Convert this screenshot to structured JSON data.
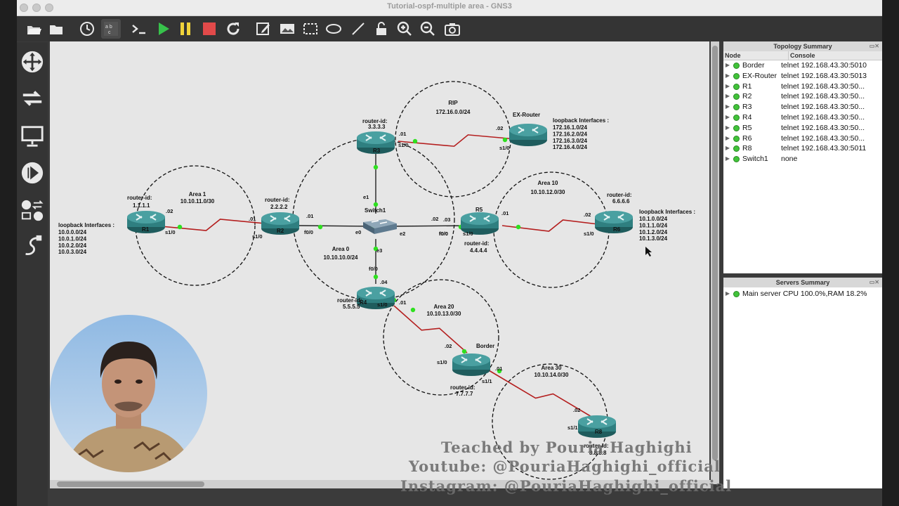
{
  "window": {
    "title": "Tutorial-ospf-multiple area - GNS3"
  },
  "toolbar": {
    "buttons": [
      {
        "name": "open-project-button",
        "icon": "folder-open-icon"
      },
      {
        "name": "open-folder-button",
        "icon": "folder-icon"
      },
      {
        "name": "snapshot-button",
        "icon": "clock-icon"
      },
      {
        "name": "show-labels-button",
        "icon": "abc-icon"
      },
      {
        "name": "console-all-button",
        "icon": "terminal-icon"
      },
      {
        "name": "start-all-button",
        "icon": "play-icon"
      },
      {
        "name": "suspend-all-button",
        "icon": "pause-icon"
      },
      {
        "name": "stop-all-button",
        "icon": "stop-icon"
      },
      {
        "name": "reload-all-button",
        "icon": "reload-icon"
      },
      {
        "name": "add-note-button",
        "icon": "edit-icon"
      },
      {
        "name": "insert-picture-button",
        "icon": "picture-icon"
      },
      {
        "name": "draw-rectangle-button",
        "icon": "rectangle-icon"
      },
      {
        "name": "draw-ellipse-button",
        "icon": "ellipse-icon"
      },
      {
        "name": "draw-line-button",
        "icon": "line-icon"
      },
      {
        "name": "lock-items-button",
        "icon": "lock-icon"
      },
      {
        "name": "zoom-in-button",
        "icon": "zoom-in-icon"
      },
      {
        "name": "zoom-out-button",
        "icon": "zoom-out-icon"
      },
      {
        "name": "screenshot-button",
        "icon": "camera-icon"
      }
    ]
  },
  "sidebar": {
    "items": [
      {
        "name": "browse-routers-button",
        "icon": "router-icon"
      },
      {
        "name": "browse-switches-button",
        "icon": "switch-icon"
      },
      {
        "name": "browse-end-devices-button",
        "icon": "monitor-icon"
      },
      {
        "name": "browse-security-devices-button",
        "icon": "security-icon"
      },
      {
        "name": "browse-all-devices-button",
        "icon": "all-devices-icon"
      },
      {
        "name": "add-link-button",
        "icon": "cable-icon"
      }
    ]
  },
  "topology": {
    "areas": [
      {
        "id": "rip",
        "label": "RIP",
        "subnet": "172.16.0.0/24"
      },
      {
        "id": "area1",
        "label": "Area 1",
        "subnet": "10.10.11.0/30"
      },
      {
        "id": "area0",
        "label": "Area 0",
        "subnet": "10.10.10.0/24"
      },
      {
        "id": "area10",
        "label": "Area 10",
        "subnet": "10.10.12.0/30"
      },
      {
        "id": "area20",
        "label": "Area 20",
        "subnet": "10.10.13.0/30"
      },
      {
        "id": "area30",
        "label": "Area 30",
        "subnet": "10.10.14.0/30"
      }
    ],
    "routers": [
      {
        "name": "R1",
        "rid_label": "router-id:",
        "rid": "1.1.1.1"
      },
      {
        "name": "R2",
        "rid_label": "router-id:",
        "rid": "2.2.2.2"
      },
      {
        "name": "R3",
        "rid_label": "router-id:",
        "rid": "3.3.3.3"
      },
      {
        "name": "R5",
        "rid_label": "router-id:",
        "rid": "4.4.4.4"
      },
      {
        "name": "R6",
        "rid_label": "router-id:",
        "rid": "6.6.6.6"
      },
      {
        "name": "R4",
        "rid_label": "router-id:",
        "rid": "5.5.5.5"
      },
      {
        "name": "Border",
        "rid_label": "router-id:",
        "rid": "7.7.7.7"
      },
      {
        "name": "R8",
        "rid_label": "router-id:",
        "rid": "8.8.8.8"
      },
      {
        "name": "EX-Router",
        "rid_label": "",
        "rid": ""
      }
    ],
    "switch": {
      "name": "Switch1"
    },
    "loopbacks": {
      "r1": {
        "title": "loopback Interfaces :",
        "items": [
          "10.0.0.0/24",
          "10.0.1.0/24",
          "10.0.2.0/24",
          "10.0.3.0/24"
        ]
      },
      "ex": {
        "title": "loopback Interfaces :",
        "items": [
          "172.16.1.0/24",
          "172.16.2.0/24",
          "172.16.3.0/24",
          "172.16.4.0/24"
        ]
      },
      "r6": {
        "title": "loopback Interfaces :",
        "items": [
          "10.1.0.0/24",
          "10.1.1.0/24",
          "10.1.2.0/24",
          "10.1.3.0/24"
        ]
      }
    },
    "interface_labels": [
      ".02",
      "s1/0",
      ".01",
      "s1/0",
      ".01",
      "f0/0",
      "s1/0",
      ".01",
      ".02",
      "s1/0",
      ".02",
      "f0/0",
      "e1",
      "e0",
      "e2",
      "e3",
      ".03",
      "f0/0",
      "s1/0",
      ".01",
      ".02",
      "s1/0",
      "f0/0",
      ".04",
      "s1/0",
      ".01",
      ".02",
      "s1/0",
      ".01",
      "s1/1",
      ".02",
      "s1/1"
    ]
  },
  "topology_summary": {
    "title": "Topology Summary",
    "col_node": "Node",
    "col_console": "Console",
    "rows": [
      {
        "node": "Border",
        "console": "telnet 192.168.43.30:5010"
      },
      {
        "node": "EX-Router",
        "console": "telnet 192.168.43.30:5013"
      },
      {
        "node": "R1",
        "console": "telnet 192.168.43.30:50..."
      },
      {
        "node": "R2",
        "console": "telnet 192.168.43.30:50..."
      },
      {
        "node": "R3",
        "console": "telnet 192.168.43.30:50..."
      },
      {
        "node": "R4",
        "console": "telnet 192.168.43.30:50..."
      },
      {
        "node": "R5",
        "console": "telnet 192.168.43.30:50..."
      },
      {
        "node": "R6",
        "console": "telnet 192.168.43.30:50..."
      },
      {
        "node": "R8",
        "console": "telnet 192.168.43.30:5011"
      },
      {
        "node": "Switch1",
        "console": "none"
      }
    ]
  },
  "servers_summary": {
    "title": "Servers Summary",
    "rows": [
      {
        "text": "Main server CPU 100.0%,RAM 18.2%"
      }
    ]
  },
  "watermark": {
    "line1": "Teached by Pouria Haghighi",
    "line2": "Youtube: @PouriaHaghighi_official",
    "line3": "Instagram: @PouriaHaghighi_official"
  },
  "colors": {
    "link_serial": "#b41e1e",
    "link_ethernet": "#222222",
    "port_up": "#2ee01f",
    "router_body": "#2f7f80",
    "canvas_bg": "#e6e6e6"
  }
}
